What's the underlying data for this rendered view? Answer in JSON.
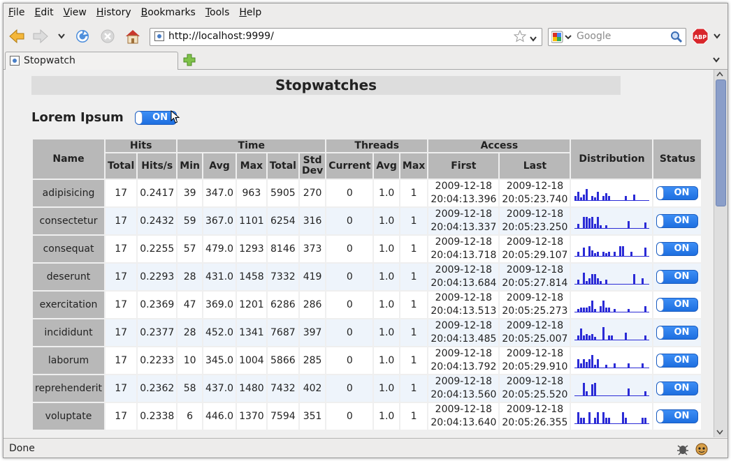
{
  "menu": [
    "File",
    "Edit",
    "View",
    "History",
    "Bookmarks",
    "Tools",
    "Help"
  ],
  "url": "http://localhost:9999/",
  "search_placeholder": "Google",
  "tab_title": "Stopwatch",
  "status_text": "Done",
  "page": {
    "title": "Stopwatches",
    "group": "Lorem Ipsum",
    "group_toggle": "ON"
  },
  "headers": {
    "name": "Name",
    "hits": "Hits",
    "time": "Time",
    "threads": "Threads",
    "access": "Access",
    "distribution": "Distribution",
    "status": "Status",
    "total": "Total",
    "hits_s": "Hits/s",
    "min": "Min",
    "avg": "Avg",
    "max": "Max",
    "std_dev": "Std Dev",
    "current": "Current",
    "first": "First",
    "last": "Last"
  },
  "rows": [
    {
      "name": "adipisicing",
      "total": "17",
      "hps": "0.2417",
      "min": "39",
      "avg": "347.0",
      "max": "963",
      "ttotal": "5905",
      "std": "270",
      "cur": "0",
      "tavg": "1.0",
      "tmax": "1",
      "first_d": "2009-12-18",
      "first_t": "20:04:13.396",
      "last_d": "2009-12-18",
      "last_t": "20:05:23.740",
      "status": "ON",
      "dist": [
        3,
        6,
        2,
        4,
        8,
        0,
        3,
        2,
        6,
        0,
        3,
        5,
        3,
        0,
        0,
        0,
        0,
        0,
        3,
        0,
        0,
        4,
        0,
        0,
        0,
        0
      ]
    },
    {
      "name": "consectetur",
      "total": "17",
      "hps": "0.2432",
      "min": "59",
      "avg": "367.0",
      "max": "1101",
      "ttotal": "6254",
      "std": "316",
      "cur": "0",
      "tavg": "1.0",
      "tmax": "1",
      "first_d": "2009-12-18",
      "first_t": "20:04:13.337",
      "last_d": "2009-12-18",
      "last_t": "20:05:23.250",
      "status": "ON",
      "dist": [
        0,
        3,
        0,
        8,
        8,
        7,
        8,
        3,
        8,
        2,
        0,
        2,
        0,
        0,
        0,
        0,
        0,
        0,
        0,
        5,
        0,
        0,
        0,
        0,
        0,
        4
      ]
    },
    {
      "name": "consequat",
      "total": "17",
      "hps": "0.2255",
      "min": "57",
      "avg": "479.0",
      "max": "1293",
      "ttotal": "8146",
      "std": "373",
      "cur": "0",
      "tavg": "1.0",
      "tmax": "1",
      "first_d": "2009-12-18",
      "first_t": "20:04:13.718",
      "last_d": "2009-12-18",
      "last_t": "20:05:29.107",
      "status": "ON",
      "dist": [
        0,
        3,
        0,
        6,
        0,
        7,
        4,
        2,
        3,
        0,
        3,
        2,
        3,
        0,
        3,
        0,
        7,
        7,
        0,
        0,
        3,
        0,
        0,
        0,
        0,
        6
      ]
    },
    {
      "name": "deserunt",
      "total": "17",
      "hps": "0.2293",
      "min": "28",
      "avg": "431.0",
      "max": "1458",
      "ttotal": "7332",
      "std": "419",
      "cur": "0",
      "tavg": "1.0",
      "tmax": "1",
      "first_d": "2009-12-18",
      "first_t": "20:04:13.684",
      "last_d": "2009-12-18",
      "last_t": "20:05:27.814",
      "status": "ON",
      "dist": [
        0,
        3,
        0,
        8,
        2,
        4,
        7,
        7,
        4,
        2,
        0,
        3,
        0,
        0,
        0,
        0,
        0,
        0,
        0,
        0,
        0,
        7,
        0,
        0,
        4,
        0
      ]
    },
    {
      "name": "exercitation",
      "total": "17",
      "hps": "0.2369",
      "min": "47",
      "avg": "369.0",
      "max": "1201",
      "ttotal": "6286",
      "std": "286",
      "cur": "0",
      "tavg": "1.0",
      "tmax": "1",
      "first_d": "2009-12-18",
      "first_t": "20:04:13.513",
      "last_d": "2009-12-18",
      "last_t": "20:05:25.273",
      "status": "ON",
      "dist": [
        0,
        2,
        3,
        3,
        3,
        4,
        8,
        2,
        0,
        4,
        8,
        3,
        3,
        0,
        2,
        0,
        0,
        0,
        0,
        2,
        0,
        0,
        0,
        0,
        0,
        4
      ]
    },
    {
      "name": "incididunt",
      "total": "17",
      "hps": "0.2377",
      "min": "28",
      "avg": "452.0",
      "max": "1341",
      "ttotal": "7687",
      "std": "397",
      "cur": "0",
      "tavg": "1.0",
      "tmax": "1",
      "first_d": "2009-12-18",
      "first_t": "20:04:13.485",
      "last_d": "2009-12-18",
      "last_t": "20:05:25.007",
      "status": "ON",
      "dist": [
        0,
        3,
        8,
        3,
        4,
        3,
        4,
        2,
        0,
        0,
        9,
        0,
        3,
        3,
        0,
        0,
        0,
        0,
        5,
        0,
        0,
        0,
        0,
        0,
        0,
        3
      ]
    },
    {
      "name": "laborum",
      "total": "17",
      "hps": "0.2233",
      "min": "10",
      "avg": "345.0",
      "max": "1004",
      "ttotal": "5866",
      "std": "285",
      "cur": "0",
      "tavg": "1.0",
      "tmax": "1",
      "first_d": "2009-12-18",
      "first_t": "20:04:13.792",
      "last_d": "2009-12-18",
      "last_t": "20:05:29.910",
      "status": "ON",
      "dist": [
        0,
        6,
        3,
        6,
        4,
        6,
        9,
        2,
        6,
        0,
        0,
        2,
        0,
        0,
        3,
        0,
        0,
        0,
        0,
        3,
        0,
        0,
        0,
        0,
        3,
        0
      ]
    },
    {
      "name": "reprehenderit",
      "total": "17",
      "hps": "0.2362",
      "min": "58",
      "avg": "437.0",
      "max": "1480",
      "ttotal": "7432",
      "std": "402",
      "cur": "0",
      "tavg": "1.0",
      "tmax": "1",
      "first_d": "2009-12-18",
      "first_t": "20:04:13.560",
      "last_d": "2009-12-18",
      "last_t": "20:05:25.520",
      "status": "ON",
      "dist": [
        0,
        0,
        0,
        9,
        3,
        0,
        8,
        9,
        0,
        0,
        0,
        0,
        0,
        0,
        0,
        0,
        0,
        0,
        0,
        5,
        0,
        0,
        0,
        0,
        0,
        3
      ]
    },
    {
      "name": "voluptate",
      "total": "17",
      "hps": "0.2338",
      "min": "6",
      "avg": "446.0",
      "max": "1370",
      "ttotal": "7594",
      "std": "351",
      "cur": "0",
      "tavg": "1.0",
      "tmax": "1",
      "first_d": "2009-12-18",
      "first_t": "20:04:13.640",
      "last_d": "2009-12-18",
      "last_t": "20:05:26.355",
      "status": "ON",
      "dist": [
        0,
        8,
        4,
        4,
        0,
        8,
        0,
        4,
        8,
        0,
        8,
        4,
        4,
        0,
        0,
        0,
        0,
        8,
        4,
        0,
        0,
        0,
        0,
        0,
        4,
        4
      ]
    }
  ],
  "colors": {
    "toggle": "#2b7be8",
    "bar": "#2b2bd6",
    "header_bg": "#b8b8b8",
    "alt_row": "#eef4fb"
  }
}
